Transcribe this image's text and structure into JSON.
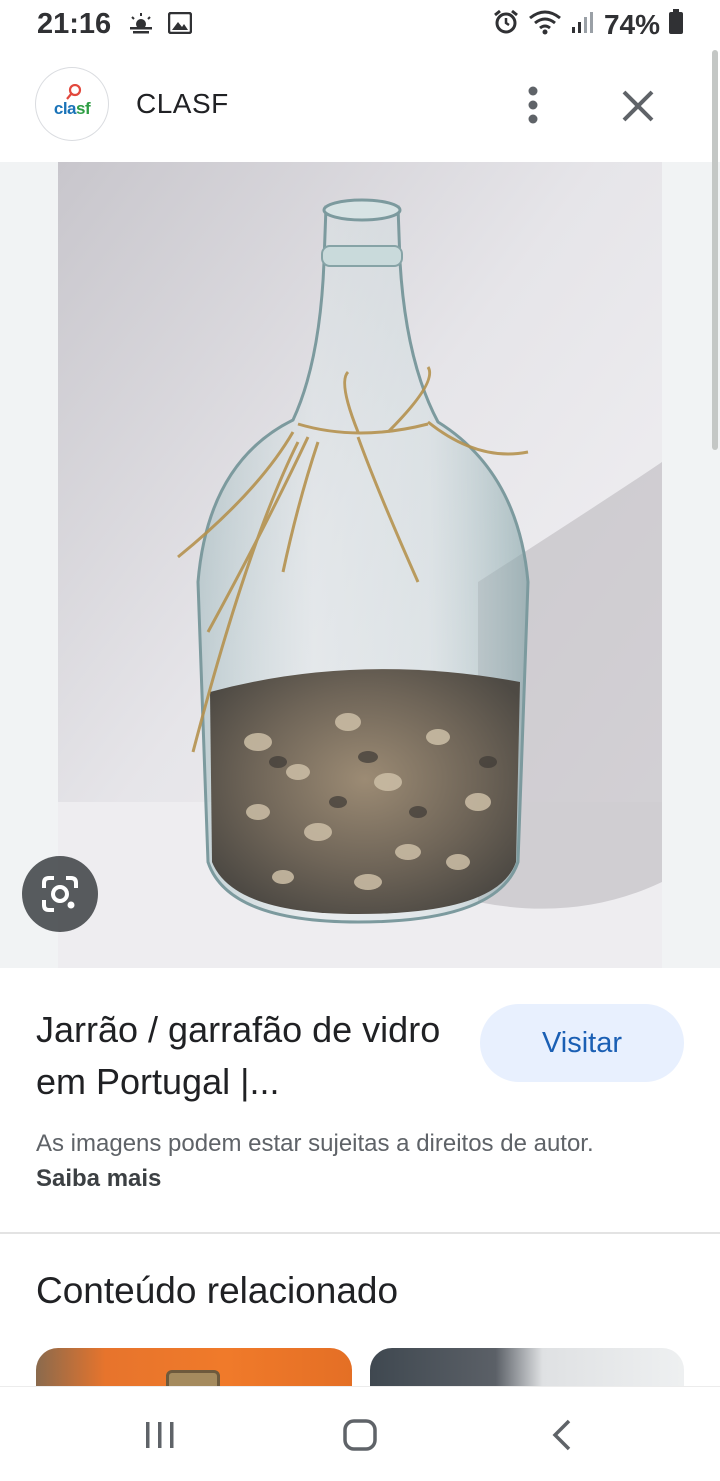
{
  "status_bar": {
    "time": "21:16",
    "battery": "74%",
    "icons": [
      "weather-icon",
      "image-icon",
      "alarm-icon",
      "wifi-icon",
      "signal-icon",
      "battery-icon"
    ]
  },
  "header": {
    "site_name": "CLASF",
    "logo_text_blue": "cla",
    "logo_text_green": "sf",
    "icons": [
      "more-vert-icon",
      "close-icon"
    ]
  },
  "result": {
    "title": "Jarrão / garrafão de vidro em Portugal |...",
    "visit_label": "Visitar",
    "copyright_text": "As imagens podem estar sujeitas a direitos de autor. ",
    "learn_more": "Saiba mais"
  },
  "related": {
    "title": "Conteúdo relacionado"
  },
  "colors": {
    "accent": "#1a5fb4",
    "visit_bg": "#e8f0fe"
  }
}
